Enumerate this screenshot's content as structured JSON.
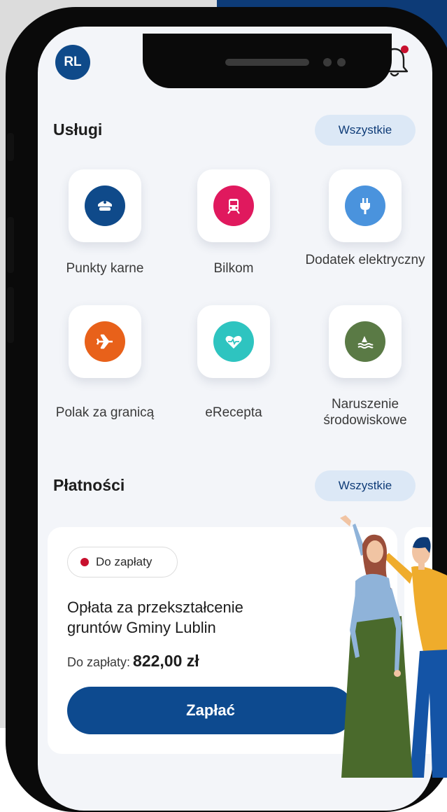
{
  "header": {
    "avatar_initials": "RL",
    "notification_icon": "bell-icon"
  },
  "services": {
    "title": "Usługi",
    "all_label": "Wszystkie",
    "items": [
      {
        "label": "Punkty karne",
        "icon": "police-cap-icon",
        "color": "#0f4a8a"
      },
      {
        "label": "Bilkom",
        "icon": "train-icon",
        "color": "#e0195e"
      },
      {
        "label": "Dodatek elektryczny",
        "icon": "plug-icon",
        "color": "#4a93dd"
      },
      {
        "label": "Polak za granicą",
        "icon": "airplane-icon",
        "color": "#e8611a"
      },
      {
        "label": "eRecepta",
        "icon": "heart-pulse-icon",
        "color": "#2ec4c0"
      },
      {
        "label": "Naruszenie środowiskowe",
        "icon": "water-buoy-icon",
        "color": "#5a7a45"
      }
    ]
  },
  "payments": {
    "title": "Płatności",
    "all_label": "Wszystkie",
    "card": {
      "status": "Do zapłaty",
      "title": "Opłata za przekształcenie gruntów Gminy Lublin",
      "amount_label": "Do zapłaty:",
      "amount": "822,00 zł",
      "pay_button": "Zapłać"
    }
  },
  "colors": {
    "primary": "#0d4a8f",
    "accent_red": "#c8102e",
    "pill_bg": "#dce8f6"
  }
}
